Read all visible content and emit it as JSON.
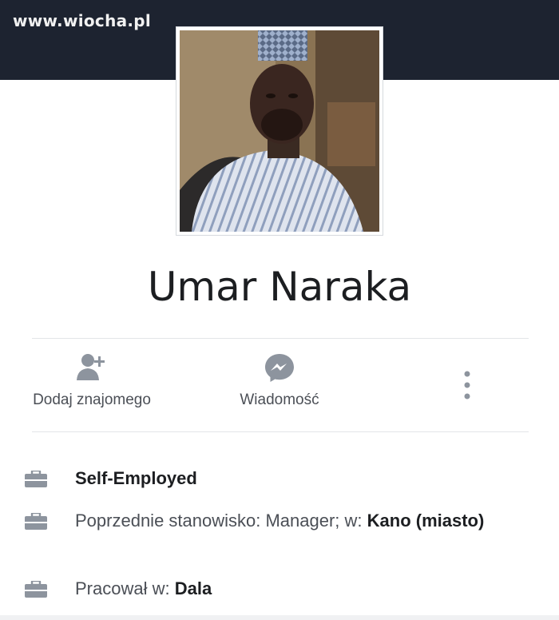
{
  "watermark": "www.wiocha.pl",
  "profile": {
    "name": "Umar Naraka"
  },
  "actions": {
    "add_friend_label": "Dodaj znajomego",
    "message_label": "Wiadomość"
  },
  "info": {
    "employment": "Self-Employed",
    "previous_prefix": "Poprzednie stanowisko: Manager; w: ",
    "previous_place": "Kano (miasto)",
    "worked_prefix": "Pracował w: ",
    "worked_place": "Dala"
  },
  "icons": {
    "add_friend": "add-friend-icon",
    "messenger": "messenger-icon",
    "more": "more-options-icon",
    "work": "briefcase-icon"
  },
  "colors": {
    "cover": "#1d2330",
    "icon_gray": "#8d949e",
    "text_dark": "#1c1e21",
    "text_secondary": "#4b4f56"
  }
}
